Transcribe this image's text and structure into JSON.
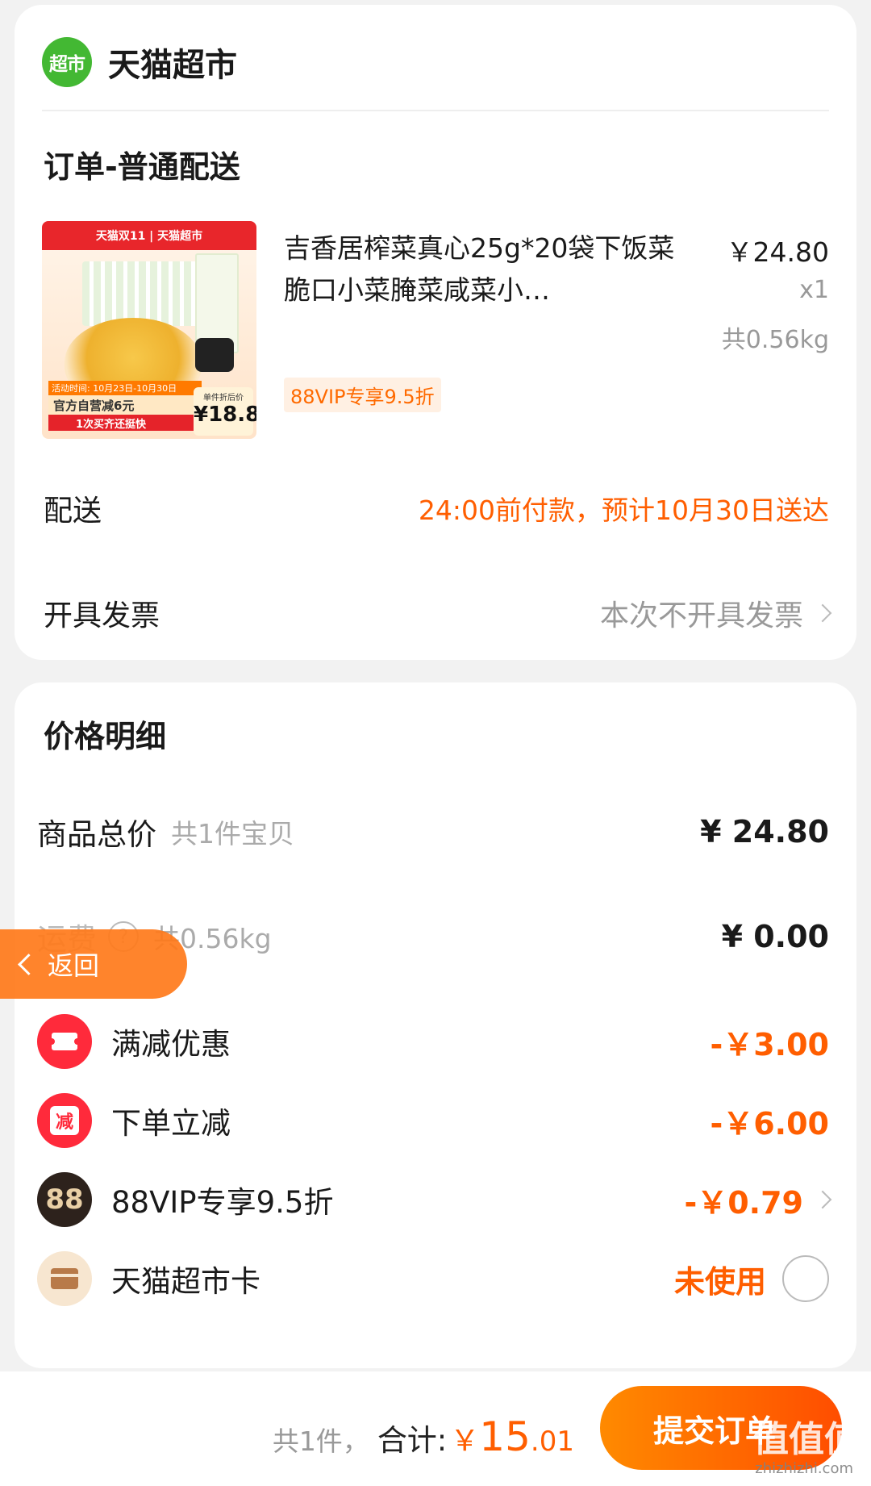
{
  "store": {
    "logo_text": "超市",
    "name": "天猫超市"
  },
  "order": {
    "section_title": "订单-普通配送",
    "product": {
      "title": "吉香居榨菜真心25g*20袋下饭菜脆口小菜腌菜咸菜小…",
      "price": "￥24.80",
      "quantity": "x1",
      "weight": "共0.56kg",
      "vip_tag": "88VIP专享9.5折",
      "image": {
        "banner": "天猫双11 | 天猫超市",
        "promo_dates": "活动时间: 10月23日-10月30日",
        "promo_main": "官方自营减6元",
        "promo_sub": "1次买齐还挺快",
        "price_label": "单件折后价",
        "price_value": "¥18.8"
      }
    },
    "delivery": {
      "label": "配送",
      "value": "24:00前付款，预计10月30日送达"
    },
    "invoice": {
      "label": "开具发票",
      "value": "本次不开具发票"
    }
  },
  "price_detail": {
    "title": "价格明细",
    "goods_total": {
      "label": "商品总价",
      "sub": "共1件宝贝",
      "amount": "¥ 24.80"
    },
    "shipping": {
      "label": "运费",
      "sub": "共0.56kg",
      "amount": "¥ 0.00",
      "help_icon": "?"
    },
    "discount": {
      "label": "满减优惠",
      "amount": "-￥3.00"
    },
    "instant": {
      "label": "下单立减",
      "amount": "-￥6.00",
      "icon_text": "减"
    },
    "vip": {
      "label": "88VIP专享9.5折",
      "amount": "-￥0.79",
      "icon_text": "88"
    },
    "card": {
      "label": "天猫超市卡",
      "status": "未使用"
    }
  },
  "back_button": {
    "label": "返回"
  },
  "bottom": {
    "count": "共1件，",
    "total_label": "合计:",
    "currency": "￥",
    "total_int": "15",
    "total_dec": ".01",
    "submit_label": "提交订单"
  },
  "watermark": {
    "text": "值值值",
    "sub": "zhizhizhi.com"
  },
  "colors": {
    "accent": "#ff5e00",
    "logo_green": "#43b833",
    "icon_red": "#ff2a3b"
  }
}
